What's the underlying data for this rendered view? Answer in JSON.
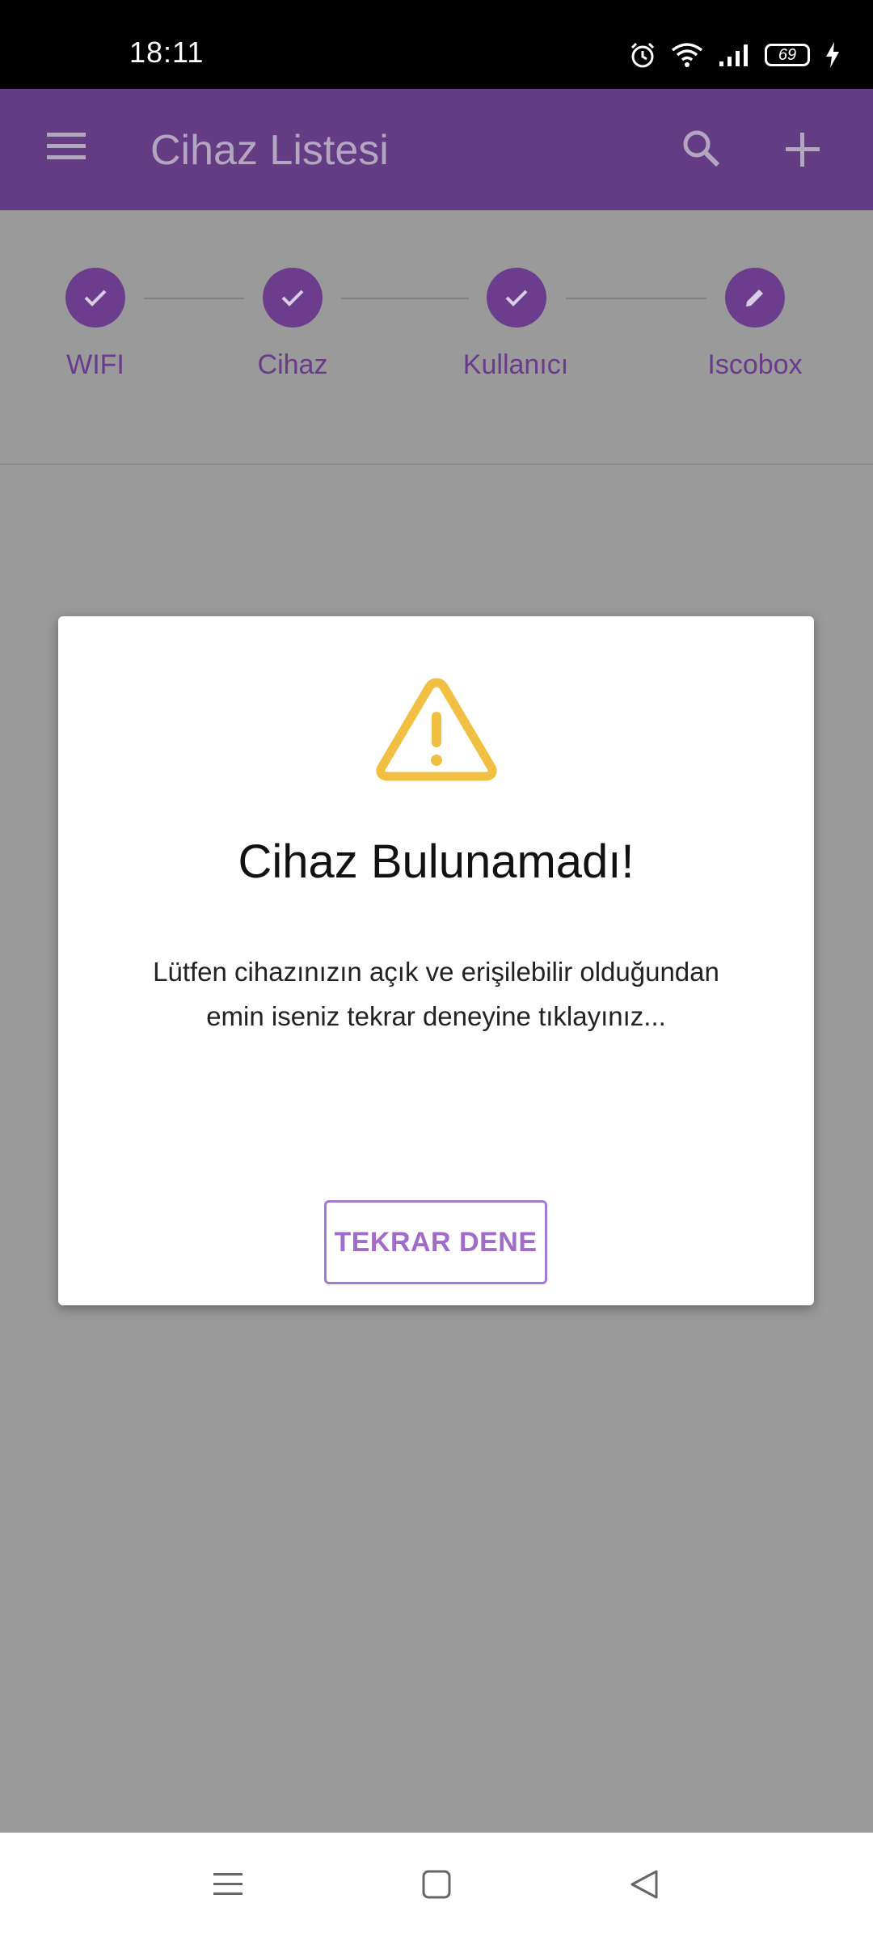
{
  "status_bar": {
    "time": "18:11",
    "battery": "69",
    "icons": [
      "alarm-icon",
      "wifi-icon",
      "signal-icon",
      "battery-icon",
      "charging-icon"
    ]
  },
  "app_bar": {
    "title": "Cihaz Listesi",
    "color": "#643c84",
    "icons": [
      "menu-icon",
      "search-icon",
      "add-icon"
    ]
  },
  "stepper": {
    "steps": [
      {
        "label": "WIFI",
        "state": "done"
      },
      {
        "label": "Cihaz",
        "state": "done"
      },
      {
        "label": "Kullanıcı",
        "state": "done"
      },
      {
        "label": "Iscobox",
        "state": "editing"
      }
    ],
    "accent": "#6c3d8d"
  },
  "dialog": {
    "icon": "warning-icon",
    "title": "Cihaz Bulunamadı!",
    "message": "Lütfen cihazınızın açık ve erişilebilir olduğundan emin iseniz tekrar deneyine tıklayınız...",
    "button_label": "TEKRAR DENE",
    "warning_color": "#f1c042"
  },
  "nav_bar": {
    "icons": [
      "recent-apps-icon",
      "home-icon",
      "back-icon"
    ]
  }
}
